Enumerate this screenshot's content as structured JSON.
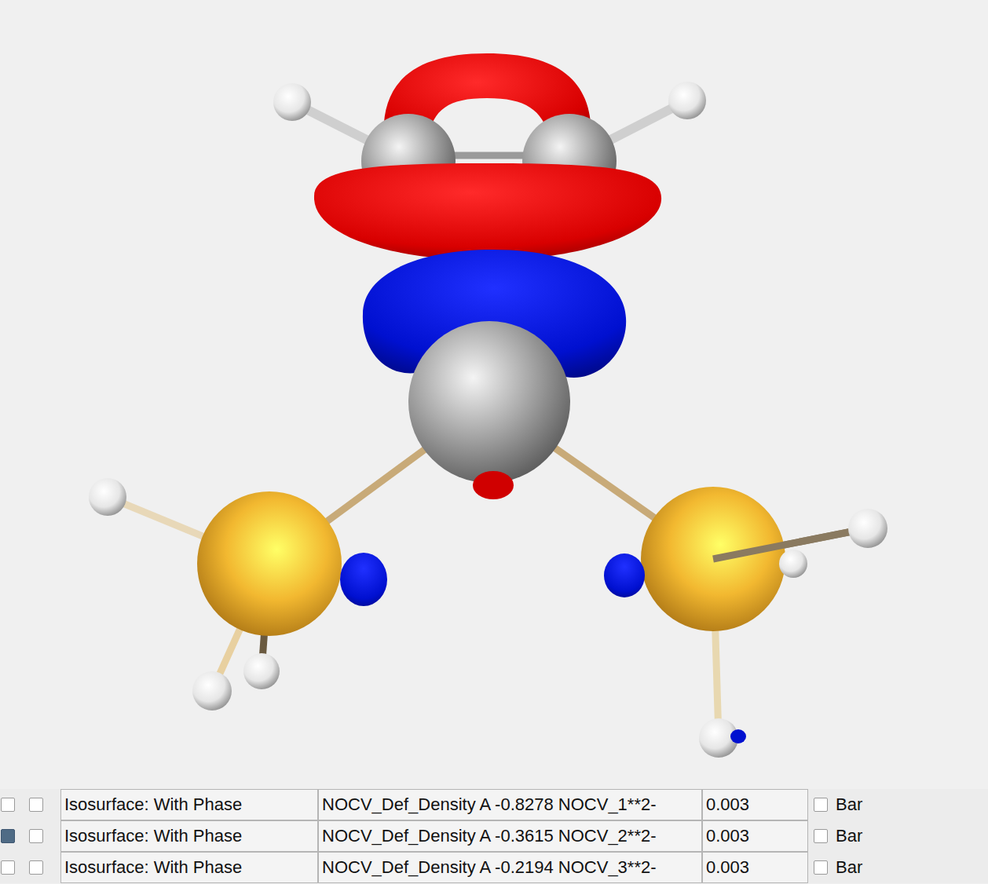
{
  "isosurfaces": [
    {
      "visible": false,
      "locked": false,
      "type": "Isosurface: With Phase",
      "field": "NOCV_Def_Density A -0.8278 NOCV_1**2-",
      "isovalue": "0.003",
      "bar": false,
      "bar_label": "Bar"
    },
    {
      "visible": true,
      "locked": false,
      "type": "Isosurface: With Phase",
      "field": "NOCV_Def_Density A -0.3615 NOCV_2**2-",
      "isovalue": "0.003",
      "bar": false,
      "bar_label": "Bar"
    },
    {
      "visible": false,
      "locked": false,
      "type": "Isosurface: With Phase",
      "field": "NOCV_Def_Density A -0.2194 NOCV_3**2-",
      "isovalue": "0.003",
      "bar": false,
      "bar_label": "Bar"
    }
  ]
}
